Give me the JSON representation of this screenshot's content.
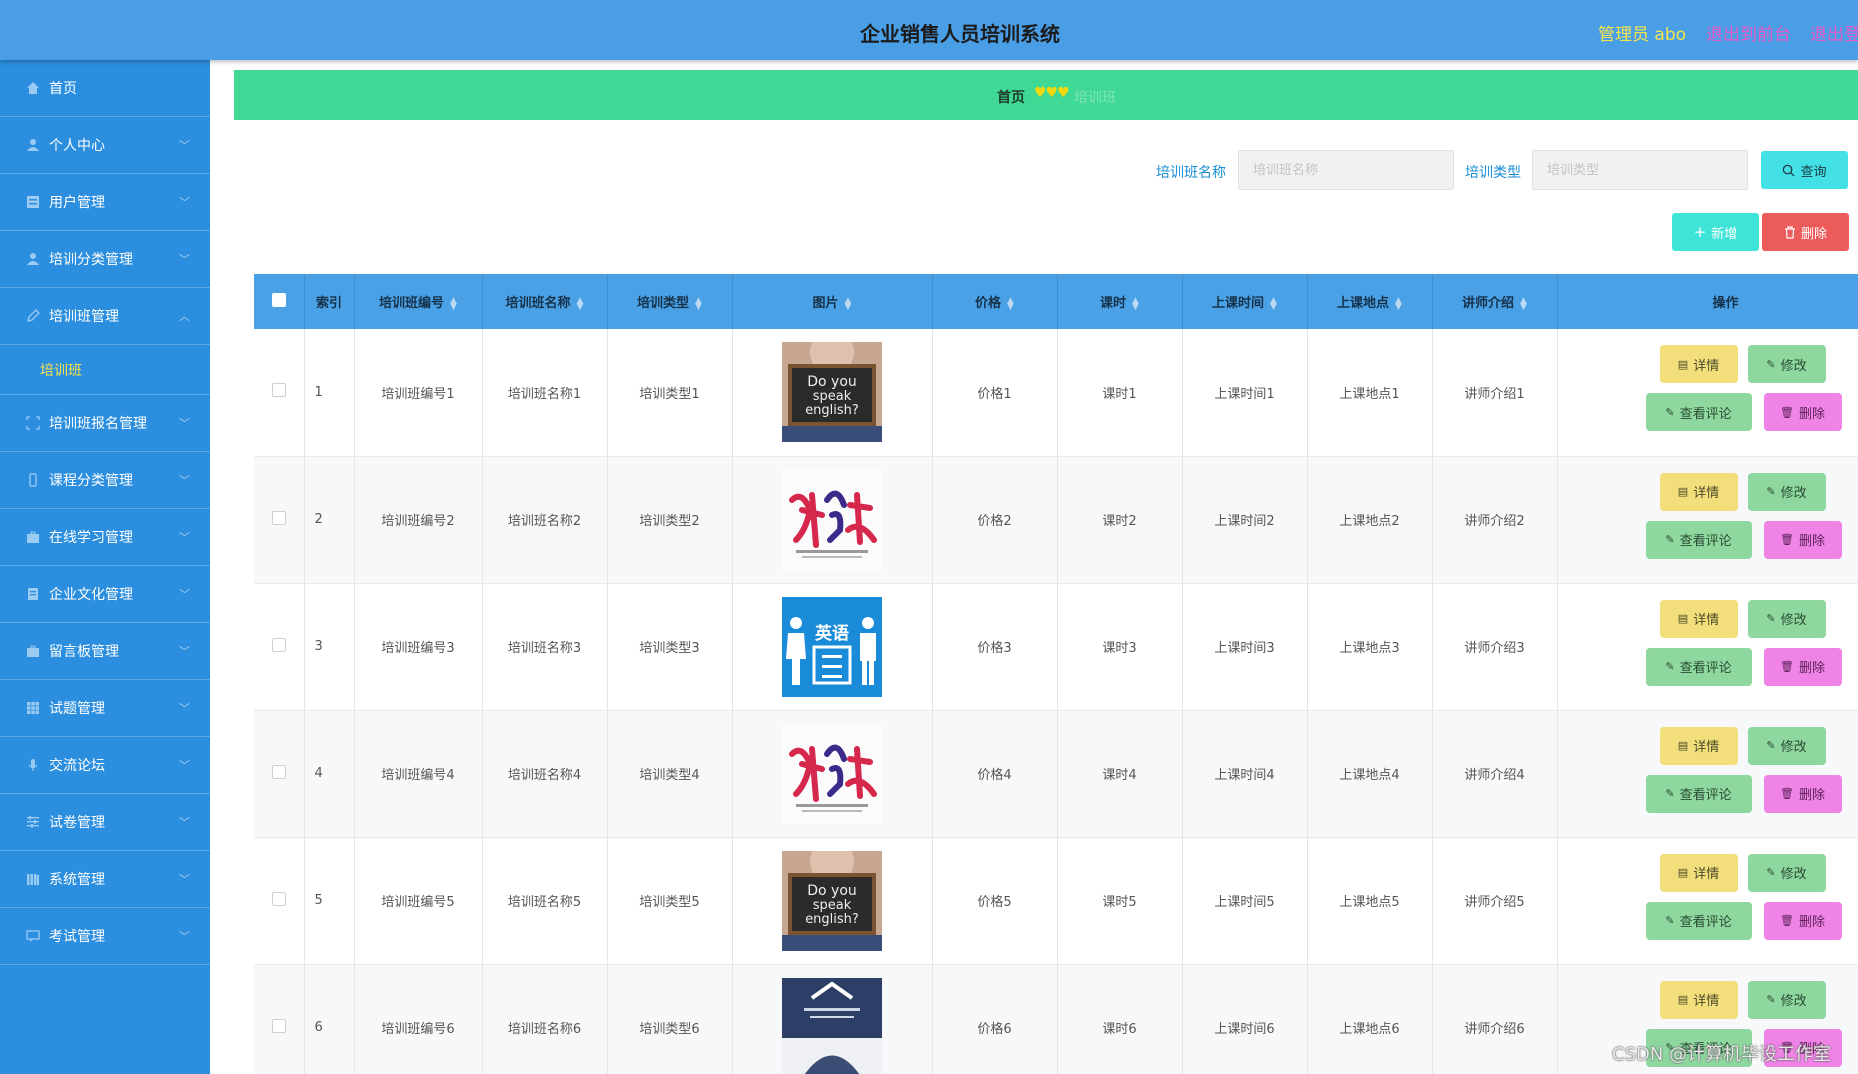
{
  "header": {
    "title": "企业销售人员培训系统",
    "admin": "管理员 abo",
    "exit_front": "退出到前台",
    "exit_login": "退出登"
  },
  "sidebar": {
    "items": [
      {
        "label": "首页",
        "icon": "home-icon"
      },
      {
        "label": "个人中心",
        "icon": "user-icon"
      },
      {
        "label": "用户管理",
        "icon": "list-icon"
      },
      {
        "label": "培训分类管理",
        "icon": "user-icon"
      },
      {
        "label": "培训班管理",
        "icon": "edit-icon",
        "expanded": true
      },
      {
        "label": "培训班报名管理",
        "icon": "frame-icon"
      },
      {
        "label": "课程分类管理",
        "icon": "mobile-icon"
      },
      {
        "label": "在线学习管理",
        "icon": "briefcase-icon"
      },
      {
        "label": "企业文化管理",
        "icon": "document-icon"
      },
      {
        "label": "留言板管理",
        "icon": "briefcase-icon"
      },
      {
        "label": "试题管理",
        "icon": "grid-icon"
      },
      {
        "label": "交流论坛",
        "icon": "microphone-icon"
      },
      {
        "label": "试卷管理",
        "icon": "sliders-icon"
      },
      {
        "label": "系统管理",
        "icon": "library-icon"
      },
      {
        "label": "考试管理",
        "icon": "message-icon"
      }
    ],
    "sub_item": "培训班"
  },
  "breadcrumb": {
    "home": "首页",
    "separator": "♥♥♥",
    "current": "培训班"
  },
  "search": {
    "name_label": "培训班名称",
    "name_placeholder": "培训班名称",
    "type_label": "培训类型",
    "type_placeholder": "培训类型",
    "query": "查询",
    "add": "新增",
    "delete": "删除"
  },
  "table": {
    "columns": [
      "索引",
      "培训班编号",
      "培训班名称",
      "培训类型",
      "图片",
      "价格",
      "课时",
      "上课时间",
      "上课地点",
      "讲师介绍",
      "操作"
    ],
    "rows": [
      {
        "index": "1",
        "code": "培训班编号1",
        "name": "培训班名称1",
        "type": "培训类型1",
        "image": "do-you-speak-english",
        "price": "价格1",
        "hours": "课时1",
        "time": "上课时间1",
        "place": "上课地点1",
        "teacher": "讲师介绍1"
      },
      {
        "index": "2",
        "code": "培训班编号2",
        "name": "培训班名称2",
        "type": "培训类型2",
        "image": "calligraphy",
        "price": "价格2",
        "hours": "课时2",
        "time": "上课时间2",
        "place": "上课地点2",
        "teacher": "讲师介绍2"
      },
      {
        "index": "3",
        "code": "培训班编号3",
        "name": "培训班名称3",
        "type": "培训类型3",
        "image": "english-poster",
        "price": "价格3",
        "hours": "课时3",
        "time": "上课时间3",
        "place": "上课地点3",
        "teacher": "讲师介绍3"
      },
      {
        "index": "4",
        "code": "培训班编号4",
        "name": "培训班名称4",
        "type": "培训类型4",
        "image": "calligraphy",
        "price": "价格4",
        "hours": "课时4",
        "time": "上课时间4",
        "place": "上课地点4",
        "teacher": "讲师介绍4"
      },
      {
        "index": "5",
        "code": "培训班编号5",
        "name": "培训班名称5",
        "type": "培训类型5",
        "image": "do-you-speak-english",
        "price": "价格5",
        "hours": "课时5",
        "time": "上课时间5",
        "place": "上课地点5",
        "teacher": "讲师介绍5"
      },
      {
        "index": "6",
        "code": "培训班编号6",
        "name": "培训班名称6",
        "type": "培训类型6",
        "image": "book-cover",
        "price": "价格6",
        "hours": "课时6",
        "time": "上课时间6",
        "place": "上课地点6",
        "teacher": "讲师介绍6"
      }
    ],
    "actions": {
      "detail": "详情",
      "edit": "修改",
      "review": "查看评论",
      "delete": "删除"
    }
  },
  "watermark": "CSDN @计算机毕设工作室",
  "colors": {
    "header": "#4a9ee6",
    "sidebar": "#2b8ede",
    "breadcrumb": "#3fd895",
    "query": "#43e0e6",
    "add": "#3fe3d7",
    "delete": "#ec5c5c",
    "detail": "#f2de7a",
    "edit": "#8ed8a0",
    "row_delete": "#ef84e6"
  }
}
